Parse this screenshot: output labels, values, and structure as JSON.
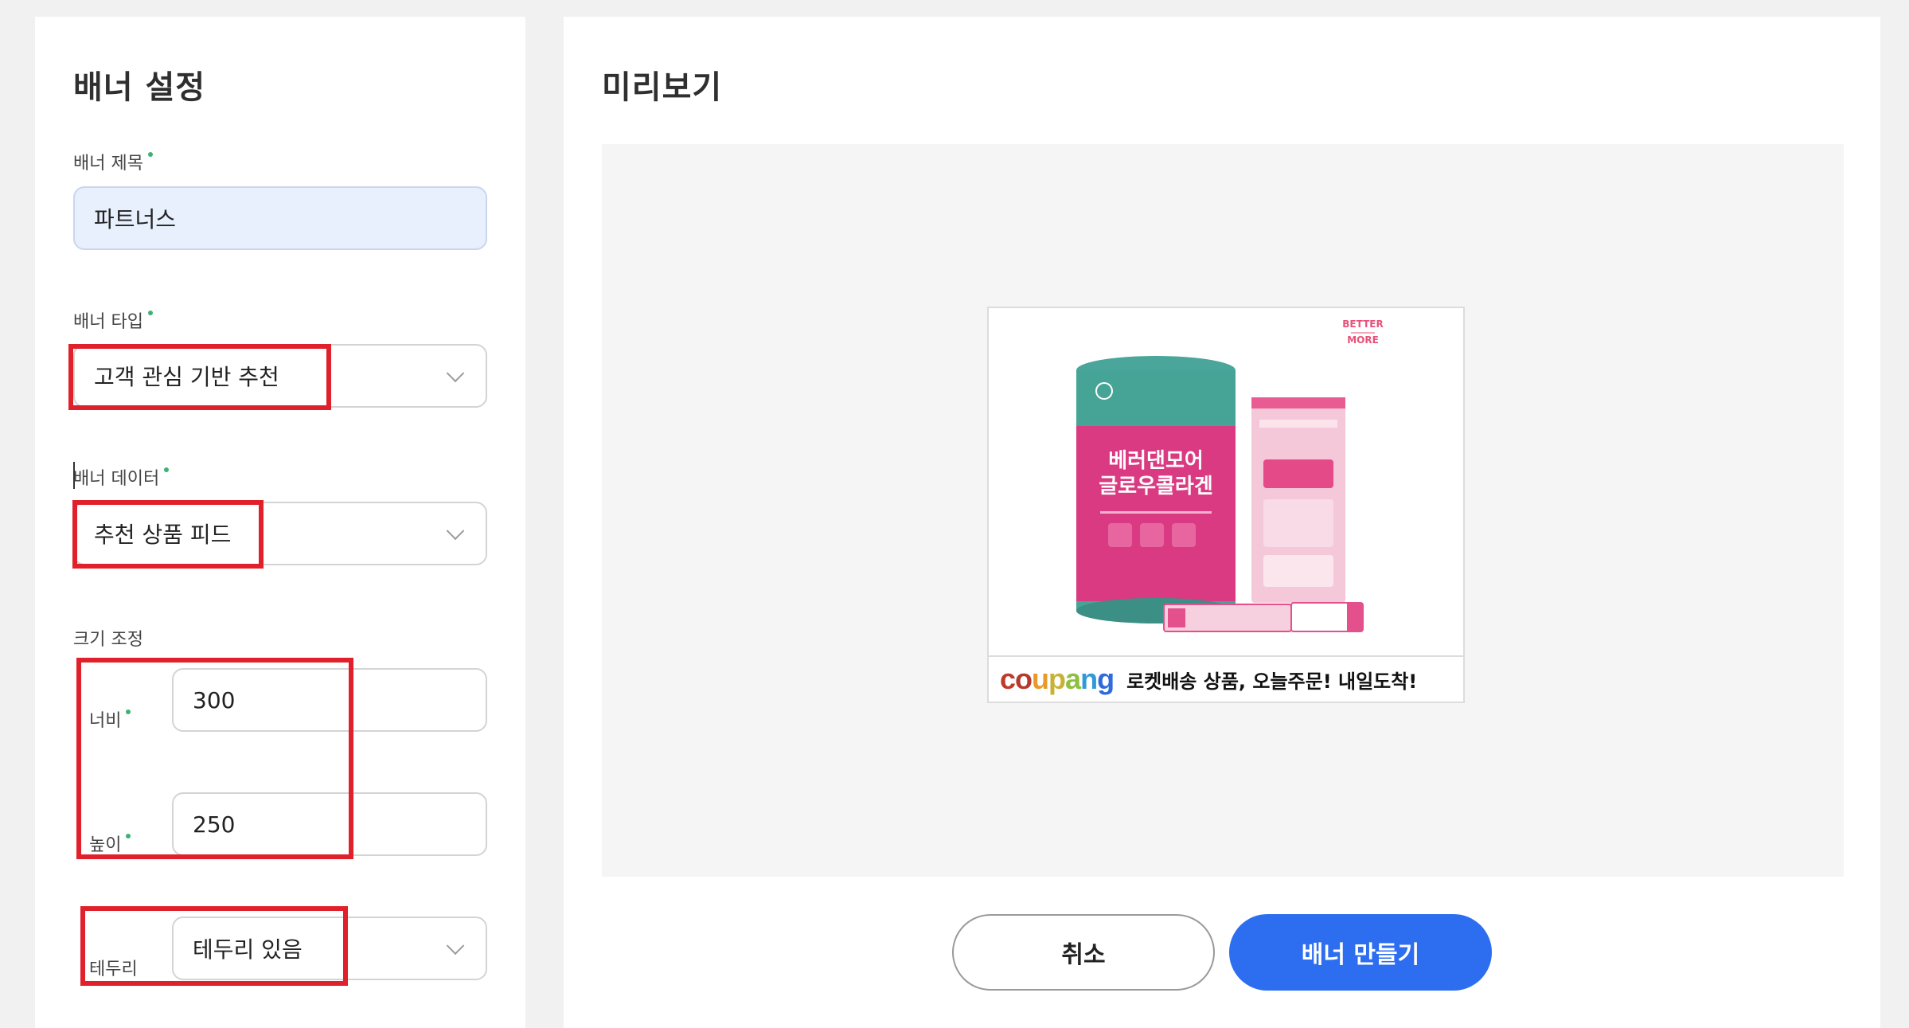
{
  "settings": {
    "title": "배너 설정",
    "banner_title": {
      "label": "배너 제목",
      "value": "파트너스"
    },
    "banner_type": {
      "label": "배너 타입",
      "value": "고객 관심 기반 추천"
    },
    "banner_data": {
      "label": "배너 데이터",
      "value": "추천 상품 피드"
    },
    "size": {
      "label": "크기 조정",
      "width_label": "너비",
      "width_value": "300",
      "height_label": "높이",
      "height_value": "250"
    },
    "border": {
      "label": "테두리",
      "value": "테두리 있음"
    }
  },
  "preview": {
    "title": "미리보기",
    "banner": {
      "brand_top": "BETTER",
      "brand_bottom": "MORE",
      "product_line1": "베러댄모어",
      "product_line2": "글로우콜라겐",
      "logo": "coupang",
      "tagline": "로켓배송 상품, 오늘주문! 내일도착!"
    }
  },
  "actions": {
    "cancel": "취소",
    "create": "배너 만들기"
  },
  "colors": {
    "accent": "#2d6ef0",
    "highlight": "#e0202a",
    "required_dot": "#3cb371",
    "input_filled": "#e8f0fe"
  }
}
